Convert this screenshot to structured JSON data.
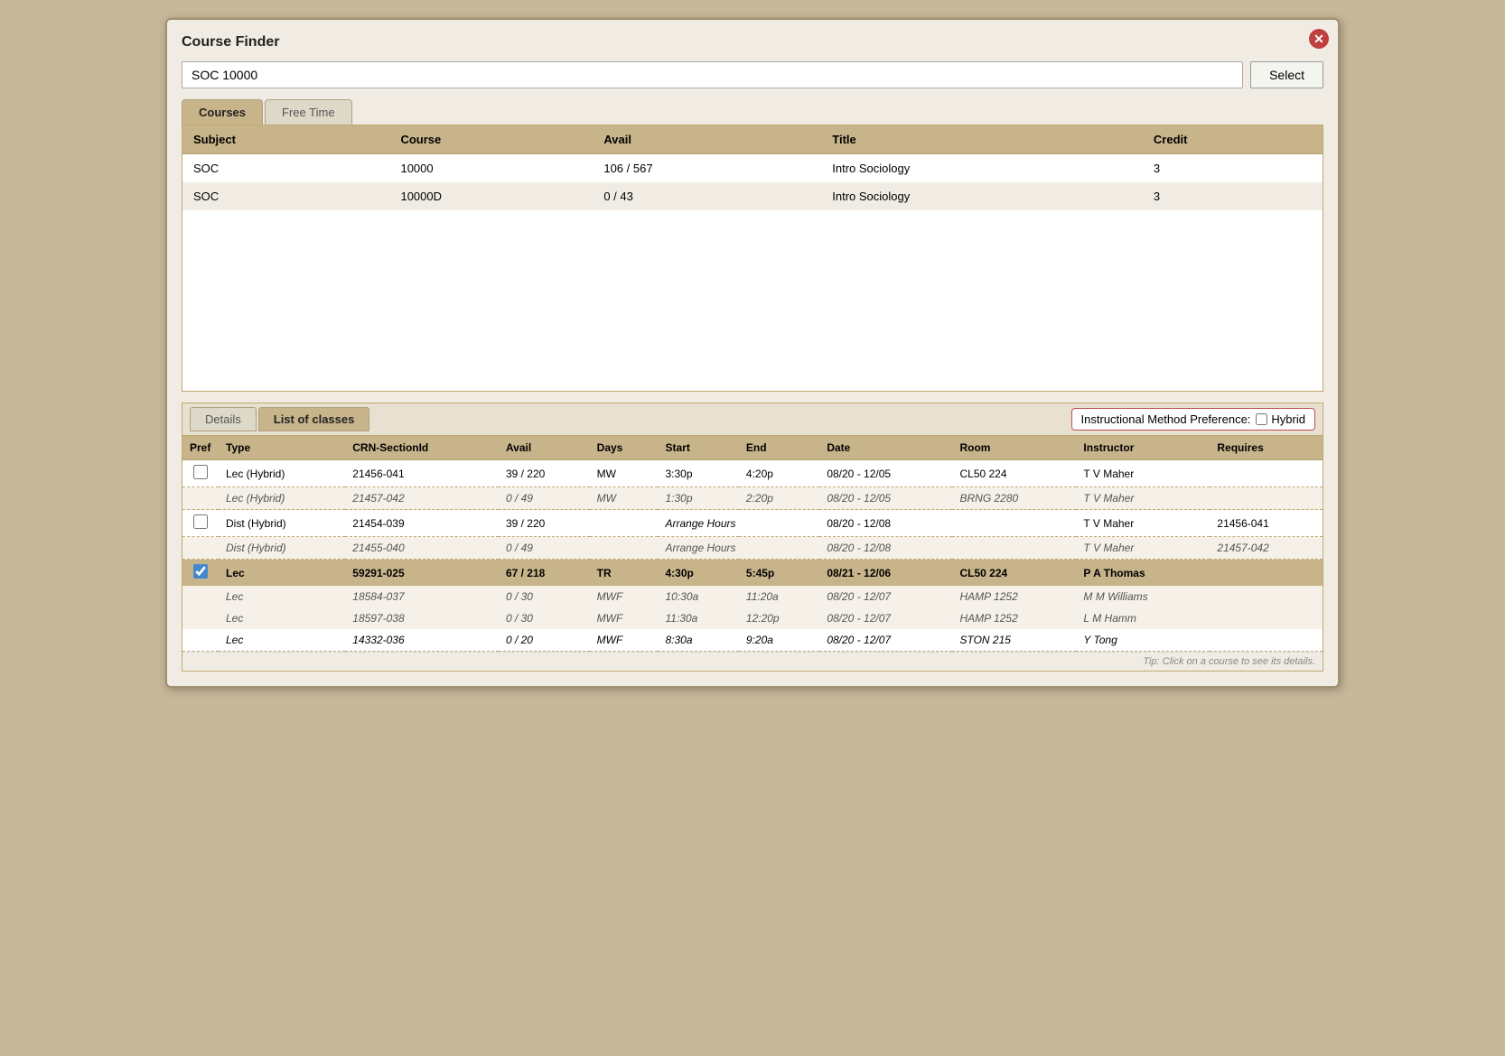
{
  "dialog": {
    "title": "Course Finder",
    "search_value": "SOC 10000",
    "select_label": "Select",
    "close_symbol": "✕"
  },
  "tabs": {
    "courses_label": "Courses",
    "free_time_label": "Free Time"
  },
  "top_table": {
    "headers": [
      "Subject",
      "Course",
      "Avail",
      "Title",
      "Credit"
    ],
    "rows": [
      {
        "subject": "SOC",
        "course": "10000",
        "avail": "106 / 567",
        "title": "Intro Sociology",
        "credit": "3"
      },
      {
        "subject": "SOC",
        "course": "10000D",
        "avail": "0 / 43",
        "title": "Intro Sociology",
        "credit": "3"
      }
    ]
  },
  "bottom_section": {
    "tabs": {
      "details_label": "Details",
      "list_label": "List of classes"
    },
    "method_pref_label": "Instructional Method Preference:",
    "hybrid_label": "Hybrid"
  },
  "bottom_table": {
    "headers": [
      "Pref",
      "Type",
      "CRN-SectionId",
      "Avail",
      "Days",
      "Start",
      "End",
      "Date",
      "Room",
      "Instructor",
      "Requires"
    ],
    "groups": [
      {
        "main": {
          "pref": false,
          "type": "Lec (Hybrid)",
          "crn": "21456-041",
          "avail": "39 / 220",
          "days": "MW",
          "start": "3:30p",
          "end": "4:20p",
          "date": "08/20 - 12/05",
          "room": "CL50 224",
          "instructor": "T V Maher",
          "requires": ""
        },
        "alt": {
          "pref": false,
          "type": "Lec (Hybrid)",
          "crn": "21457-042",
          "avail": "0 / 49",
          "days": "MW",
          "start": "1:30p",
          "end": "2:20p",
          "date": "08/20 - 12/05",
          "room": "BRNG 2280",
          "instructor": "T V Maher",
          "requires": ""
        }
      },
      {
        "main": {
          "pref": false,
          "type": "Dist (Hybrid)",
          "crn": "21454-039",
          "avail": "39 / 220",
          "days": "",
          "start": "Arrange Hours",
          "end": "",
          "date": "08/20 - 12/08",
          "room": "",
          "instructor": "T V Maher",
          "requires": "21456-041"
        },
        "alt": {
          "pref": false,
          "type": "Dist (Hybrid)",
          "crn": "21455-040",
          "avail": "0 / 49",
          "days": "",
          "start": "Arrange Hours",
          "end": "",
          "date": "08/20 - 12/08",
          "room": "",
          "instructor": "T V Maher",
          "requires": "21457-042"
        }
      },
      {
        "main": {
          "pref": true,
          "type": "Lec",
          "crn": "59291-025",
          "avail": "67 / 218",
          "days": "TR",
          "start": "4:30p",
          "end": "5:45p",
          "date": "08/21 - 12/06",
          "room": "CL50 224",
          "instructor": "P A Thomas",
          "requires": ""
        },
        "alt1": {
          "type": "Lec",
          "crn": "18584-037",
          "avail": "0 / 30",
          "days": "MWF",
          "start": "10:30a",
          "end": "11:20a",
          "date": "08/20 - 12/07",
          "room": "HAMP 1252",
          "instructor": "M M Williams",
          "requires": ""
        },
        "alt2": {
          "type": "Lec",
          "crn": "18597-038",
          "avail": "0 / 30",
          "days": "MWF",
          "start": "11:30a",
          "end": "12:20p",
          "date": "08/20 - 12/07",
          "room": "HAMP 1252",
          "instructor": "L M Hamm",
          "requires": ""
        },
        "alt3": {
          "type": "Lec",
          "crn": "14332-036",
          "avail": "0 / 20",
          "days": "MWF",
          "start": "8:30a",
          "end": "9:20a",
          "date": "08/20 - 12/07",
          "room": "STON 215",
          "instructor": "Y Tong",
          "requires": ""
        }
      }
    ]
  },
  "tip": "Tip: Click on a course to see its details."
}
